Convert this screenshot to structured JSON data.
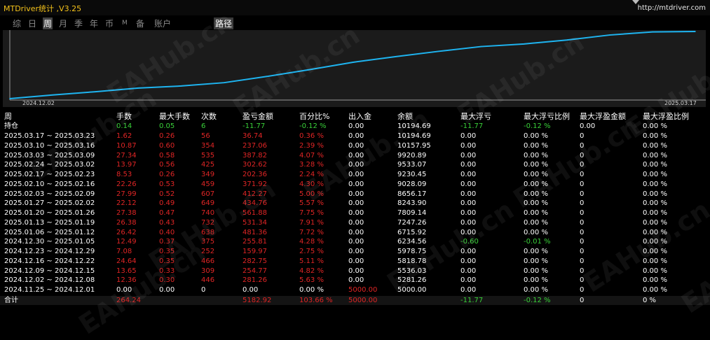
{
  "header": {
    "title": "MTDriver统计 ,V3.25",
    "link": "http://mtdriver.com"
  },
  "tabs": [
    {
      "label": "综",
      "active": false
    },
    {
      "label": "日",
      "active": false
    },
    {
      "label": "周",
      "active": true
    },
    {
      "label": "月",
      "active": false
    },
    {
      "label": "季",
      "active": false
    },
    {
      "label": "年",
      "active": false
    },
    {
      "label": "币",
      "active": false
    },
    {
      "label": "M",
      "active": false
    },
    {
      "label": "备",
      "active": false
    },
    {
      "label": "账户",
      "active": false
    },
    {
      "label": "路径",
      "active": false
    }
  ],
  "chart_data": {
    "type": "line",
    "x_start_label": "2024.12.02",
    "x_end_label": "2025.03.17",
    "line_color": "#1eb4f0",
    "background": "#1b1b1b",
    "x": [
      "2024.11.25",
      "2024.12.02",
      "2024.12.09",
      "2024.12.16",
      "2024.12.23",
      "2024.12.30",
      "2025.01.06",
      "2025.01.13",
      "2025.01.20",
      "2025.01.27",
      "2025.02.03",
      "2025.02.10",
      "2025.02.17",
      "2025.02.24",
      "2025.03.03",
      "2025.03.10",
      "2025.03.17"
    ],
    "values": [
      5000.0,
      5281.26,
      5536.03,
      5818.78,
      5978.75,
      6234.56,
      6715.92,
      7247.26,
      7809.14,
      8243.9,
      8656.17,
      9028.09,
      9230.45,
      9533.07,
      9920.89,
      10157.95,
      10194.69
    ]
  },
  "table": {
    "columns": [
      "周",
      "手数",
      "最大手数",
      "次数",
      "盈亏金额",
      "百分比%",
      "出入金",
      "余额",
      "最大浮亏",
      "最大浮亏比例",
      "最大浮盈金额",
      "最大浮盈比例"
    ],
    "holding": [
      "持仓",
      "0.14",
      "0.05",
      "6",
      "-11.77",
      "-0.12 %",
      "0.00",
      "10194.69",
      "-11.77",
      "-0.12 %",
      "0.00",
      "0.00 %"
    ],
    "rows": [
      [
        "2025.03.17 ~ 2025.03.23",
        "1.62",
        "0.26",
        "56",
        "36.74",
        "0.36 %",
        "0.00",
        "10194.69",
        "0.00",
        "0.00 %",
        "0",
        "0.00 %"
      ],
      [
        "2025.03.10 ~ 2025.03.16",
        "10.87",
        "0.60",
        "354",
        "237.06",
        "2.39 %",
        "0.00",
        "10157.95",
        "0.00",
        "0.00 %",
        "0",
        "0.00 %"
      ],
      [
        "2025.03.03 ~ 2025.03.09",
        "27.34",
        "0.58",
        "535",
        "387.82",
        "4.07 %",
        "0.00",
        "9920.89",
        "0.00",
        "0.00 %",
        "0",
        "0.00 %"
      ],
      [
        "2025.02.24 ~ 2025.03.02",
        "13.97",
        "0.56",
        "425",
        "302.62",
        "3.28 %",
        "0.00",
        "9533.07",
        "0.00",
        "0.00 %",
        "0",
        "0.00 %"
      ],
      [
        "2025.02.17 ~ 2025.02.23",
        "8.53",
        "0.26",
        "349",
        "202.36",
        "2.24 %",
        "0.00",
        "9230.45",
        "0.00",
        "0.00 %",
        "0",
        "0.00 %"
      ],
      [
        "2025.02.10 ~ 2025.02.16",
        "22.26",
        "0.53",
        "459",
        "371.92",
        "4.30 %",
        "0.00",
        "9028.09",
        "0.00",
        "0.00 %",
        "0",
        "0.00 %"
      ],
      [
        "2025.02.03 ~ 2025.02.09",
        "27.99",
        "0.52",
        "607",
        "412.27",
        "5.00 %",
        "0.00",
        "8656.17",
        "0.00",
        "0.00 %",
        "0",
        "0.00 %"
      ],
      [
        "2025.01.27 ~ 2025.02.02",
        "22.12",
        "0.49",
        "649",
        "434.76",
        "5.57 %",
        "0.00",
        "8243.90",
        "0.00",
        "0.00 %",
        "0",
        "0.00 %"
      ],
      [
        "2025.01.20 ~ 2025.01.26",
        "27.38",
        "0.47",
        "740",
        "561.88",
        "7.75 %",
        "0.00",
        "7809.14",
        "0.00",
        "0.00 %",
        "0",
        "0.00 %"
      ],
      [
        "2025.01.13 ~ 2025.01.19",
        "26.38",
        "0.43",
        "732",
        "531.34",
        "7.91 %",
        "0.00",
        "7247.26",
        "0.00",
        "0.00 %",
        "0",
        "0.00 %"
      ],
      [
        "2025.01.06 ~ 2025.01.12",
        "26.42",
        "0.40",
        "638",
        "481.36",
        "7.72 %",
        "0.00",
        "6715.92",
        "0.00",
        "0.00 %",
        "0",
        "0.00 %"
      ],
      [
        "2024.12.30 ~ 2025.01.05",
        "12.49",
        "0.37",
        "375",
        "255.81",
        "4.28 %",
        "0.00",
        "6234.56",
        "-0.60",
        "-0.01 %",
        "0",
        "0.00 %"
      ],
      [
        "2024.12.23 ~ 2024.12.29",
        "7.08",
        "0.35",
        "252",
        "159.97",
        "2.75 %",
        "0.00",
        "5978.75",
        "0.00",
        "0.00 %",
        "0",
        "0.00 %"
      ],
      [
        "2024.12.16 ~ 2024.12.22",
        "24.64",
        "0.35",
        "466",
        "282.75",
        "5.11 %",
        "0.00",
        "5818.78",
        "0.00",
        "0.00 %",
        "0",
        "0.00 %"
      ],
      [
        "2024.12.09 ~ 2024.12.15",
        "13.65",
        "0.33",
        "309",
        "254.77",
        "4.82 %",
        "0.00",
        "5536.03",
        "0.00",
        "0.00 %",
        "0",
        "0.00 %"
      ],
      [
        "2024.12.02 ~ 2024.12.08",
        "12.36",
        "0.30",
        "446",
        "281.26",
        "5.63 %",
        "0.00",
        "5281.26",
        "0.00",
        "0.00 %",
        "0",
        "0.00 %"
      ],
      [
        "2024.11.25 ~ 2024.12.01",
        "0.00",
        "0.00",
        "0",
        "0.00",
        "0.00 %",
        "5000.00",
        "5000.00",
        "0.00",
        "0.00 %",
        "0",
        "0.00 %"
      ]
    ],
    "total": [
      "合计",
      "264.24",
      "",
      "",
      "5182.92",
      "103.66 %",
      "5000.00",
      "",
      "-11.77",
      "-0.12 %",
      "0",
      "0 %"
    ]
  },
  "watermark": "EAHub.cn",
  "colors": {
    "title": "#f4c21a",
    "positive": "#e02525",
    "negative": "#39d039",
    "line": "#1eb4f0"
  }
}
